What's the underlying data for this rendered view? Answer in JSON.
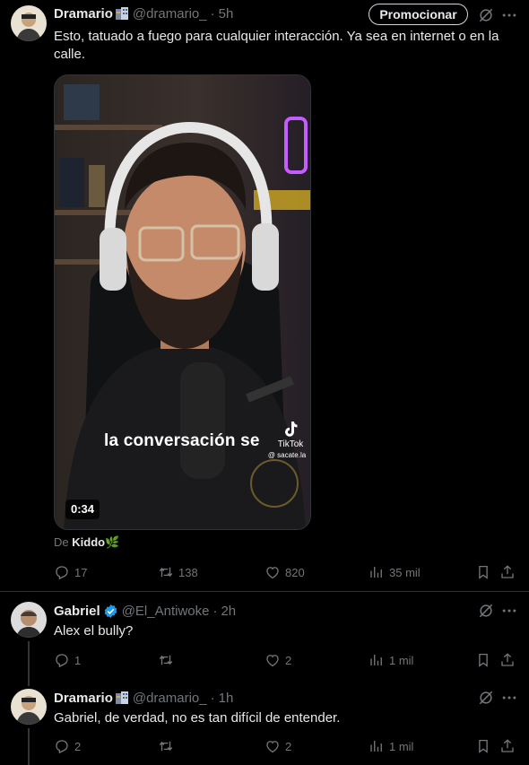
{
  "post": {
    "author_name": "Dramario",
    "author_handle": "@dramario_",
    "time": "5h",
    "promote_label": "Promocionar",
    "text": "Esto, tatuado a fuego para cualquier interacción. Ya sea en internet o en la calle.",
    "video": {
      "caption": "la conversación se",
      "duration": "0:34",
      "tiktok_label": "TikTok",
      "tiktok_handle": "@ sacate.la"
    },
    "source_prefix": "De",
    "source_name": "Kiddo",
    "stats": {
      "replies": "17",
      "reposts": "138",
      "likes": "820",
      "views": "35 mil"
    }
  },
  "replies": [
    {
      "author_name": "Gabriel",
      "author_handle": "@El_Antiwoke",
      "time": "2h",
      "verified": true,
      "text": "Alex el bully?",
      "stats": {
        "replies": "1",
        "reposts": "",
        "likes": "2",
        "views": "1 mil"
      }
    },
    {
      "author_name": "Dramario",
      "author_handle": "@dramario_",
      "time": "1h",
      "verified": false,
      "text": "Gabriel, de verdad, no es tan difícil de entender.",
      "stats": {
        "replies": "2",
        "reposts": "",
        "likes": "2",
        "views": "1 mil"
      }
    }
  ],
  "colors": {
    "background": "#000000",
    "text": "#e7e9ea",
    "muted": "#71767b",
    "verified": "#1d9bf0",
    "divider": "#2f3336"
  },
  "icons": [
    "grok-icon",
    "more-icon",
    "reply-icon",
    "repost-icon",
    "like-icon",
    "views-icon",
    "bookmark-icon",
    "share-icon",
    "verified-badge-icon",
    "tiktok-logo-icon"
  ]
}
